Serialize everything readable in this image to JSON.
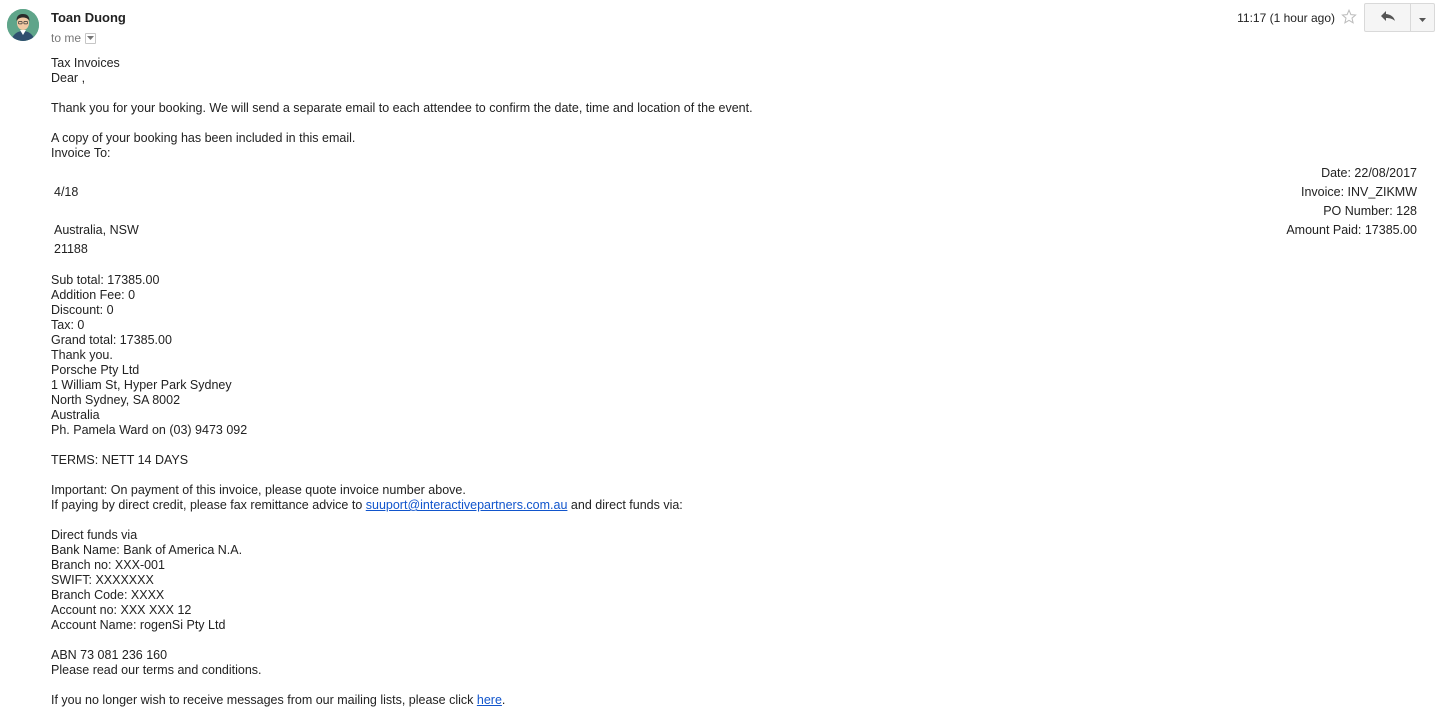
{
  "header": {
    "sender_name": "Toan Duong",
    "recipient_label": "to me",
    "time": "11:17 (1 hour ago)"
  },
  "icons": {
    "avatar": "avatar-icon",
    "star": "star-icon",
    "reply": "reply-icon",
    "more": "chevron-down-icon"
  },
  "colors": {
    "link": "#1155cc",
    "avatar_bg": "#5fa58a"
  },
  "message": {
    "title": "Tax Invoices",
    "greeting": "Dear ,",
    "thanks_line": "Thank you for your booking. We will send a separate email to each attendee to confirm the date, time and location of the event.",
    "copy_line": "A copy of your booking has been included in this email.",
    "invoice_to": "Invoice To:",
    "address": {
      "line1": "4/18",
      "line2": "Australia, NSW",
      "line3": "21188"
    },
    "invoice_meta": {
      "date": "Date: 22/08/2017",
      "invoice": "Invoice: INV_ZIKMW",
      "po_number": "PO Number: 128",
      "amount_paid": "Amount Paid: 17385.00"
    },
    "totals": {
      "sub_total": "Sub total: 17385.00",
      "addition_fee": "Addition Fee: 0",
      "discount": "Discount: 0",
      "tax": "Tax: 0",
      "grand_total": "Grand total: 17385.00"
    },
    "closing": {
      "thanks": "Thank you.",
      "company": "Porsche Pty Ltd",
      "street": "1 William St, Hyper Park Sydney",
      "city": "North Sydney, SA 8002",
      "country": "Australia",
      "phone": "Ph. Pamela Ward on (03) 9473 092"
    },
    "terms": "TERMS: NETT 14 DAYS",
    "important": "Important: On payment of this invoice, please quote invoice number above.",
    "direct_credit_prefix": "If paying by direct credit, please fax remittance advice to ",
    "direct_credit_email": "suuport@interactivepartners.com.au",
    "direct_credit_suffix": " and direct funds via:",
    "bank": {
      "heading": "Direct funds via",
      "name": "Bank Name: Bank of America N.A.",
      "branch_no": "Branch no: XXX-001",
      "swift": "SWIFT: XXXXXXX",
      "branch_code": "Branch Code: XXXX",
      "account_no": "Account no: XXX XXX 12",
      "account_name": "Account Name: rogenSi Pty Ltd"
    },
    "abn": "ABN 73 081 236 160",
    "read_terms": "Please read our terms and conditions.",
    "unsubscribe_prefix": "If you no longer wish to receive messages from our mailing lists, please click ",
    "unsubscribe_link": "here",
    "unsubscribe_suffix": "."
  }
}
